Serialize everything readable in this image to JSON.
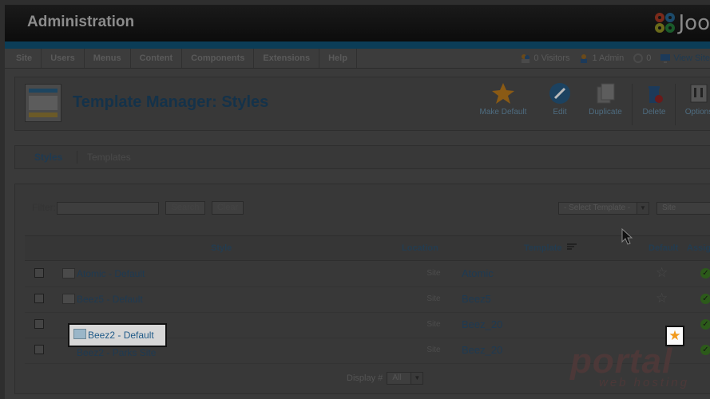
{
  "header": {
    "title": "Administration",
    "logo_text": "Joo"
  },
  "menu": {
    "items": [
      "Site",
      "Users",
      "Menus",
      "Content",
      "Components",
      "Extensions",
      "Help"
    ]
  },
  "status": {
    "visitors": "0 Visitors",
    "admins": "1 Admin",
    "messages": "0",
    "view_site": "View Site"
  },
  "page": {
    "title": "Template Manager: Styles"
  },
  "toolbar": {
    "make_default": "Make Default",
    "edit": "Edit",
    "duplicate": "Duplicate",
    "delete": "Delete",
    "options": "Options"
  },
  "tabs": {
    "styles": "Styles",
    "templates": "Templates"
  },
  "filter": {
    "label": "Filter:",
    "value": "",
    "search": "Search",
    "clear": "Clear",
    "template_select": "- Select Template -",
    "location_select": "Site"
  },
  "table": {
    "headers": {
      "style": "Style",
      "location": "Location",
      "template": "Template",
      "default": "Default",
      "assigned": "Assign"
    },
    "rows": [
      {
        "style": "Atomic - Default",
        "location": "Site",
        "template": "Atomic"
      },
      {
        "style": "Beez5 - Default",
        "location": "Site",
        "template": "Beez5"
      },
      {
        "style": "Beez2 - Default",
        "location": "Site",
        "template": "Beez_20"
      },
      {
        "style": "Beez2 - Parks Site",
        "location": "Site",
        "template": "Beez_20"
      }
    ]
  },
  "footer": {
    "display_label": "Display #",
    "display_value": "All"
  },
  "watermark": {
    "brand": "portal",
    "sub": "web hosting"
  },
  "colors": {
    "accent": "#f29a1b",
    "link": "#1e3a52",
    "check": "#2c5a1a"
  }
}
